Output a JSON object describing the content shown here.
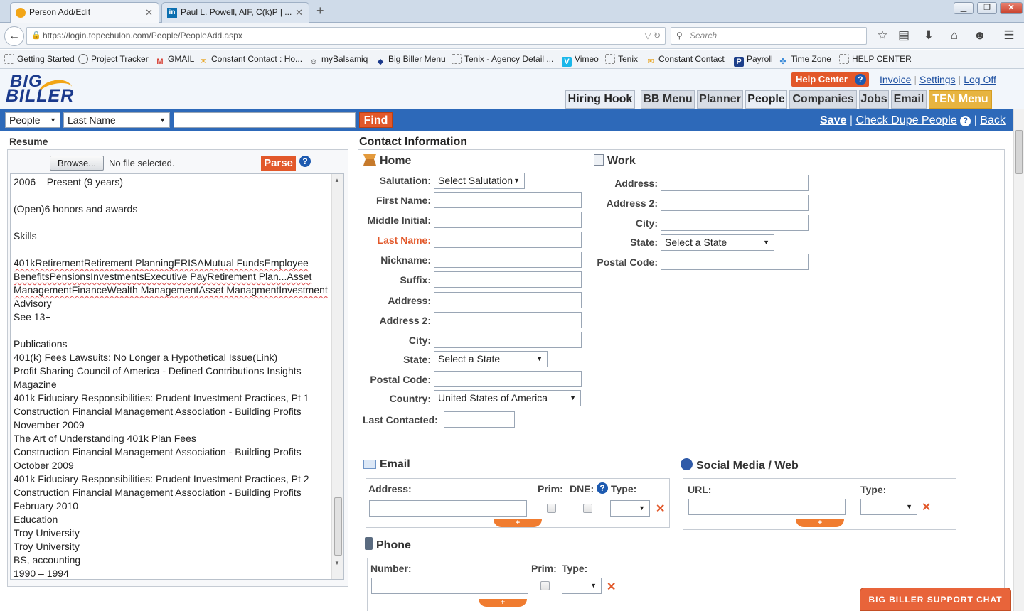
{
  "browser": {
    "tabs": [
      {
        "label": "Person Add/Edit"
      },
      {
        "label": "Paul L. Powell, AIF, C(k)P | ..."
      }
    ],
    "url": "https://login.topechulon.com/People/PeopleAdd.aspx",
    "search_placeholder": "Search",
    "bookmarks": [
      "Getting Started",
      "Project Tracker",
      "GMAIL",
      "Constant Contact : Ho...",
      "myBalsamiq",
      "Big Biller Menu",
      "Tenix - Agency Detail ...",
      "Vimeo",
      "Tenix",
      "Constant Contact",
      "Payroll",
      "Time Zone",
      "HELP CENTER"
    ]
  },
  "app": {
    "logo_line1": "BIG",
    "logo_line2": "BILLER",
    "help_center": "Help Center",
    "top_links": [
      "Invoice",
      "Settings",
      "Log Off"
    ],
    "menu_tabs": [
      "Hiring Hook",
      "BB Menu",
      "Planner",
      "People",
      "Companies",
      "Jobs",
      "Email",
      "TEN Menu"
    ],
    "search": {
      "entity": "People",
      "field": "Last Name",
      "value": "",
      "find_label": "Find"
    },
    "actions": {
      "save": "Save",
      "dupe": "Check Dupe People",
      "back": "Back",
      "sep": "|"
    }
  },
  "resume": {
    "title": "Resume",
    "browse_label": "Browse...",
    "file_status": "No file selected.",
    "parse_label": "Parse",
    "lines": [
      "2006 – Present (9 years)",
      "",
      "(Open)6 honors and awards",
      "",
      "Skills",
      "",
      "    401kRetirementRetirement PlanningERISAMutual FundsEmployee",
      "BenefitsPensionsInvestmentsExecutive PayRetirement Plan...Asset",
      "ManagementFinanceWealth ManagementAsset ManagmentInvestment",
      "Advisory",
      "    See 13+",
      "",
      "Publications",
      "401(k) Fees Lawsuits: No Longer a Hypothetical Issue(Link)",
      "Profit Sharing Council of America - Defined Contributions Insights",
      "Magazine",
      "401k Fiduciary Responsibilities: Prudent Investment Practices, Pt 1",
      "Construction Financial Management Association - Building Profits",
      "November 2009",
      "The Art of Understanding 401k Plan Fees",
      "Construction Financial Management Association - Building Profits",
      "October 2009",
      "401k Fiduciary Responsibilities: Prudent Investment Practices, Pt 2",
      "Construction Financial Management Association - Building Profits",
      "February 2010",
      "Education",
      "Troy University",
      "Troy University",
      "BS, accounting",
      "1990 – 1994"
    ]
  },
  "contact": {
    "title": "Contact Information",
    "home": {
      "title": "Home",
      "salutation_label": "Salutation:",
      "salutation_value": "Select Salutation",
      "first_name": "First Name:",
      "middle_initial": "Middle Initial:",
      "last_name": "Last Name:",
      "nickname": "Nickname:",
      "suffix": "Suffix:",
      "address": "Address:",
      "address2": "Address 2:",
      "city": "City:",
      "state_label": "State:",
      "state_value": "Select a State",
      "postal": "Postal Code:",
      "country_label": "Country:",
      "country_value": "United States of America",
      "last_contacted": "Last Contacted:"
    },
    "work": {
      "title": "Work",
      "address": "Address:",
      "address2": "Address 2:",
      "city": "City:",
      "state_label": "State:",
      "state_value": "Select a State",
      "postal": "Postal Code:"
    },
    "email": {
      "title": "Email",
      "address_label": "Address:",
      "prim_label": "Prim:",
      "dne_label": "DNE:",
      "type_label": "Type:"
    },
    "social": {
      "title": "Social Media / Web",
      "url_label": "URL:",
      "type_label": "Type:"
    },
    "phone": {
      "title": "Phone",
      "number_label": "Number:",
      "prim_label": "Prim:",
      "type_label": "Type:"
    }
  },
  "support_chat": "BIG BILLER SUPPORT CHAT",
  "colors": {
    "accent_orange": "#e2582a",
    "nav_blue": "#2d69b9",
    "ten_gold": "#e7b440"
  }
}
